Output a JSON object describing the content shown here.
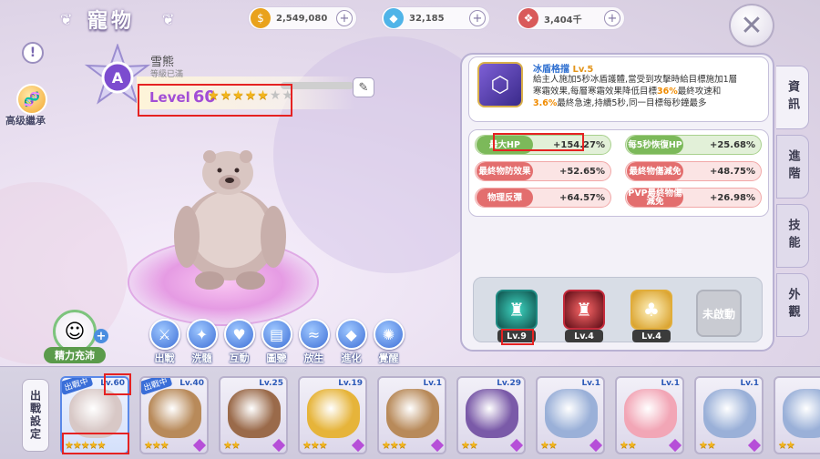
{
  "header": {
    "title": "寵物",
    "resources": [
      {
        "icon": "gold-coin-icon",
        "value": "2,549,080",
        "color": "#e9a21c"
      },
      {
        "icon": "diamond-icon",
        "value": "32,185",
        "color": "#4fb4e8"
      },
      {
        "icon": "ticket-icon",
        "value": "3,404千",
        "color": "#d95a5a"
      }
    ],
    "close": "✕"
  },
  "pet": {
    "name": "雪熊",
    "subtitle": "等級已滿",
    "rank": "A",
    "level_label": "Level",
    "level": "60",
    "stars_filled": 5,
    "stars_total": 7,
    "inherit_label": "高级繼承",
    "energy_label": "精力充沛"
  },
  "actions": [
    {
      "label": "出戰",
      "icon": "swords-icon",
      "glyph": "⚔"
    },
    {
      "label": "洗髓",
      "icon": "wash-icon",
      "glyph": "✦"
    },
    {
      "label": "互動",
      "icon": "heart-icon",
      "glyph": "♥"
    },
    {
      "label": "圖鑒",
      "icon": "book-icon",
      "glyph": "▤"
    },
    {
      "label": "放生",
      "icon": "release-icon",
      "glyph": "≈"
    },
    {
      "label": "進化",
      "icon": "crystal-icon",
      "glyph": "◆"
    },
    {
      "label": "覺醒",
      "icon": "awaken-icon",
      "glyph": "✺"
    }
  ],
  "skill": {
    "name": "冰盾格擋",
    "level": "Lv.5",
    "desc_parts": [
      "給主人施加5秒冰盾護體,當受到攻擊時給目標施加1層寒霜效果,每層寒霜效果降低目標",
      "36%",
      "最終攻速和",
      "3.6%",
      "最終急速,持續5秒,同一目標每秒鐘最多"
    ]
  },
  "stats": [
    {
      "name": "最大HP",
      "value": "+154.27%",
      "type": "green"
    },
    {
      "name": "每5秒恢復HP",
      "value": "+25.68%",
      "type": "green"
    },
    {
      "name": "最終物防效果",
      "value": "+52.65%",
      "type": "red"
    },
    {
      "name": "最終物傷減免",
      "value": "+48.75%",
      "type": "red"
    },
    {
      "name": "物理反彈",
      "value": "+64.57%",
      "type": "red"
    },
    {
      "name": "PVP最終物傷減免",
      "value": "+26.98%",
      "type": "red"
    }
  ],
  "pet_skills": [
    {
      "level": "Lv.9",
      "color": "#1e8a82",
      "icon": "skill-teal-icon"
    },
    {
      "level": "Lv.4",
      "color": "#c42a3b",
      "icon": "skill-red-icon"
    },
    {
      "level": "Lv.4",
      "color": "#e1ad3a",
      "icon": "skill-gold-icon"
    }
  ],
  "locked_skill": "未啟動",
  "tabs": [
    "資訊",
    "進階",
    "技能",
    "外觀"
  ],
  "deploy_label": "出戰設定",
  "roster": [
    {
      "level": "Lv.60",
      "stars": 5,
      "ribbon": "出戰中",
      "color": "#d8c8c6",
      "selected": true
    },
    {
      "level": "Lv.40",
      "stars": 3,
      "ribbon": "出戰中",
      "color": "#b88a5a",
      "selected": false
    },
    {
      "level": "Lv.25",
      "stars": 2,
      "ribbon": "",
      "color": "#9a6a4a",
      "selected": false
    },
    {
      "level": "Lv.19",
      "stars": 3,
      "ribbon": "",
      "color": "#e6b43a",
      "selected": false
    },
    {
      "level": "Lv.1",
      "stars": 3,
      "ribbon": "",
      "color": "#b88a5a",
      "selected": false
    },
    {
      "level": "Lv.29",
      "stars": 2,
      "ribbon": "",
      "color": "#7a5aa8",
      "selected": false
    },
    {
      "level": "Lv.1",
      "stars": 2,
      "ribbon": "",
      "color": "#9ab0d8",
      "selected": false
    },
    {
      "level": "Lv.1",
      "stars": 2,
      "ribbon": "",
      "color": "#f2a6b6",
      "selected": false
    },
    {
      "level": "Lv.1",
      "stars": 2,
      "ribbon": "",
      "color": "#9ab0d8",
      "selected": false
    },
    {
      "level": "",
      "stars": 2,
      "ribbon": "",
      "color": "#9ab0d8",
      "selected": false
    }
  ]
}
